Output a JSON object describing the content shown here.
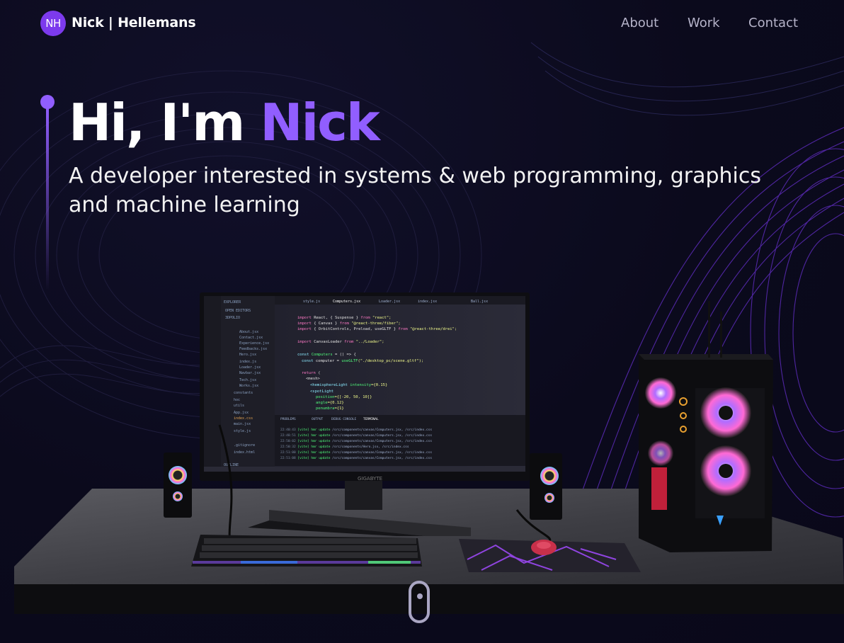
{
  "brand": {
    "initials": "NH",
    "name": "Nick | Hellemans"
  },
  "nav": {
    "links": [
      "About",
      "Work",
      "Contact"
    ]
  },
  "hero": {
    "greeting": "Hi, I'm ",
    "name": "Nick",
    "subtitle": "A developer interested in systems & web programming, graphics and machine learning"
  },
  "monitor": {
    "brand_label": "GIGABYTE",
    "tabs": [
      "style.js",
      "Computers.jsx",
      "Loader.jsx",
      "index.jsx",
      "Ball.jsx"
    ]
  },
  "colors": {
    "accent": "#915eff",
    "background": "#0b0a1c",
    "nav_text": "#b5b3c9"
  },
  "icons": {
    "scroll": "mouse-scroll-icon"
  }
}
